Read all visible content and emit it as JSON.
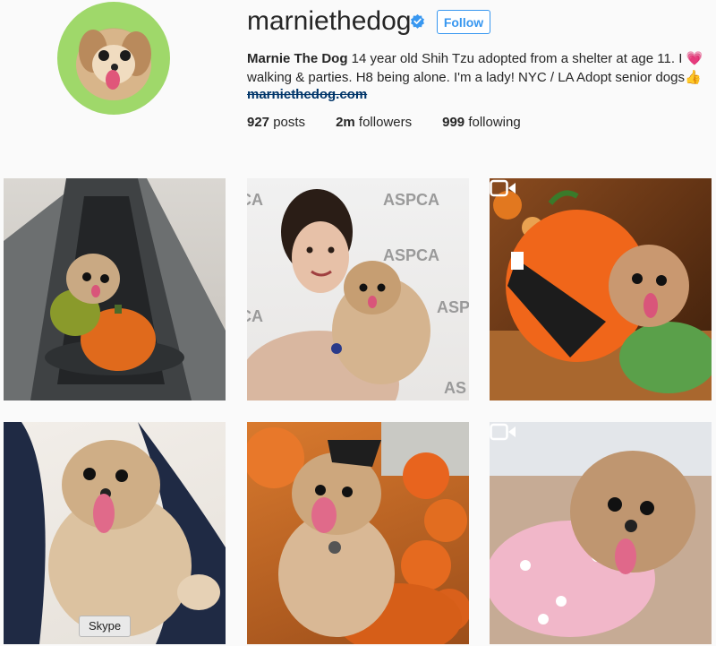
{
  "profile": {
    "username": "marniethedog",
    "follow_label": "Follow",
    "bio_name": "Marnie The Dog",
    "bio_text_1": " 14 year old Shih Tzu adopted from a shelter at age 11. I ",
    "bio_heart": "💗",
    "bio_text_2": " walking & parties. H8 being alone. I'm a lady! NYC / LA Adopt senior dogs",
    "bio_thumb": "👍",
    "website": "marniethedog.com",
    "stats": {
      "posts_count": "927",
      "posts_label": "posts",
      "followers_count": "2m",
      "followers_label": "followers",
      "following_count": "999",
      "following_label": "following"
    }
  },
  "tooltip": {
    "label": "Skype"
  },
  "colors": {
    "accent": "#3897f0",
    "verified": "#3897f0"
  }
}
